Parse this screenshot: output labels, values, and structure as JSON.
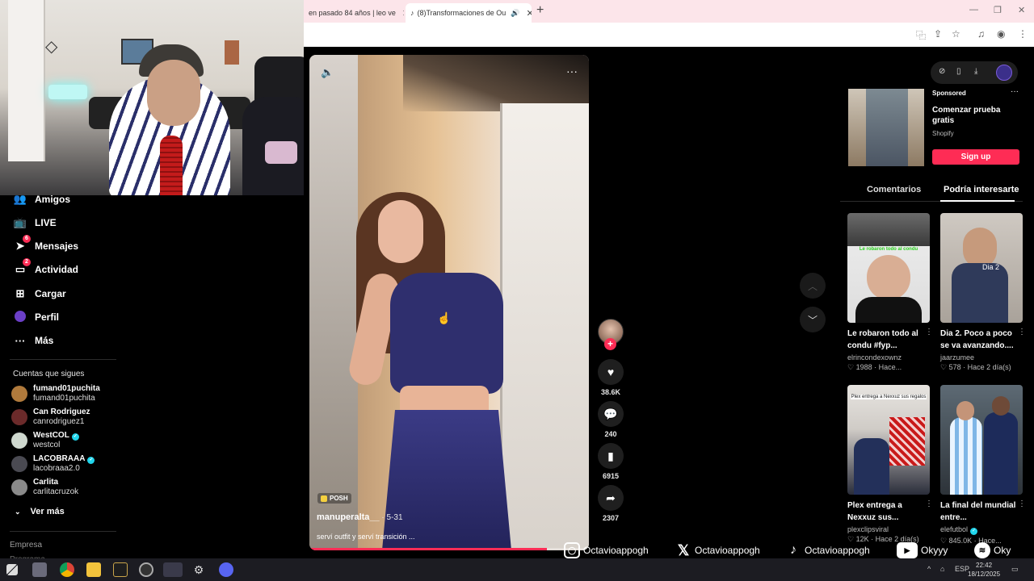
{
  "browser": {
    "tabs": [
      {
        "label": "en pasado 84 años | leo ve",
        "active": false
      },
      {
        "label": "(8)Transformaciones de Ou",
        "active": true
      }
    ],
    "new_tab_icon": "plus-icon"
  },
  "sidebar": {
    "items": [
      {
        "label": "Amigos",
        "icon": "friends-icon"
      },
      {
        "label": "LIVE",
        "icon": "live-icon"
      },
      {
        "label": "Mensajes",
        "icon": "messages-icon",
        "badge": "6"
      },
      {
        "label": "Actividad",
        "icon": "activity-icon",
        "badge": "2"
      },
      {
        "label": "Cargar",
        "icon": "upload-icon"
      },
      {
        "label": "Perfil",
        "icon": "profile-avatar"
      },
      {
        "label": "Más",
        "icon": "more-icon"
      }
    ],
    "following_title": "Cuentas que sigues",
    "following": [
      {
        "name": "fumand01puchita",
        "handle": "fumand01puchita",
        "verified": false,
        "color": "#b07a3c"
      },
      {
        "name": "Can Rodriguez",
        "handle": "canrodriguez1",
        "verified": false,
        "color": "#6b2a2a"
      },
      {
        "name": "WestCOL",
        "handle": "westcol",
        "verified": true,
        "color": "#cfd8cf"
      },
      {
        "name": "LACOBRAAA",
        "handle": "lacobraaa2.0",
        "verified": true,
        "color": "#4a4a52"
      },
      {
        "name": "Carlita",
        "handle": "carlitacruzok",
        "verified": false,
        "color": "#8a8a8a"
      }
    ],
    "see_more": "Ver más",
    "footer_1": "Empresa",
    "footer_2": "Programa"
  },
  "video": {
    "tag": "POSH",
    "username": "manuperalta__",
    "date": " · 5-31",
    "caption": "serví outfit y serví transición ...",
    "progress": 0.85,
    "likes": "38.6K",
    "comments": "240",
    "saves": "6915",
    "shares": "2307"
  },
  "right_panel": {
    "ad": {
      "sponsored": "Sponsored",
      "title": "Comenzar prueba gratis",
      "brand": "Shopify",
      "cta": "Sign up"
    },
    "tabs": [
      "Comentarios",
      "Podría interesarte"
    ],
    "cards": [
      {
        "title": "Le robaron todo al condu #fyp...",
        "author": "elrincondexownz",
        "meta": "♡ 1988 · Hace...",
        "thumb_text": "Le robaron todo al condu"
      },
      {
        "title": "Dia 2. Poco a poco se va avanzando....",
        "author": "jaarzumee",
        "meta": "♡ 578 · Hace 2 día(s)",
        "thumb_text": "Dia 2"
      },
      {
        "title": "Plex entrega a Nexxuz sus...",
        "author": "plexclipsviral",
        "meta": "♡ 12K · Hace 2 día(s)",
        "thumb_text": "Plex entrega a Nexxuz sus regalos"
      },
      {
        "title": "La final del mundial entre...",
        "author": "elefutbol",
        "meta": "♡ 845.0K · Hace...",
        "thumb_text": ""
      }
    ]
  },
  "socials": [
    {
      "icon": "instagram-icon",
      "label": "Octavioappogh"
    },
    {
      "icon": "x-icon",
      "label": "Octavioappogh"
    },
    {
      "icon": "tiktok-icon",
      "label": "Octavioappogh"
    },
    {
      "icon": "youtube-icon",
      "label": "Okyyy"
    },
    {
      "icon": "spotify-icon",
      "label": "Oky"
    }
  ],
  "taskbar": {
    "lang": "ESP",
    "time": "22:42",
    "date": "18/12/2025"
  }
}
